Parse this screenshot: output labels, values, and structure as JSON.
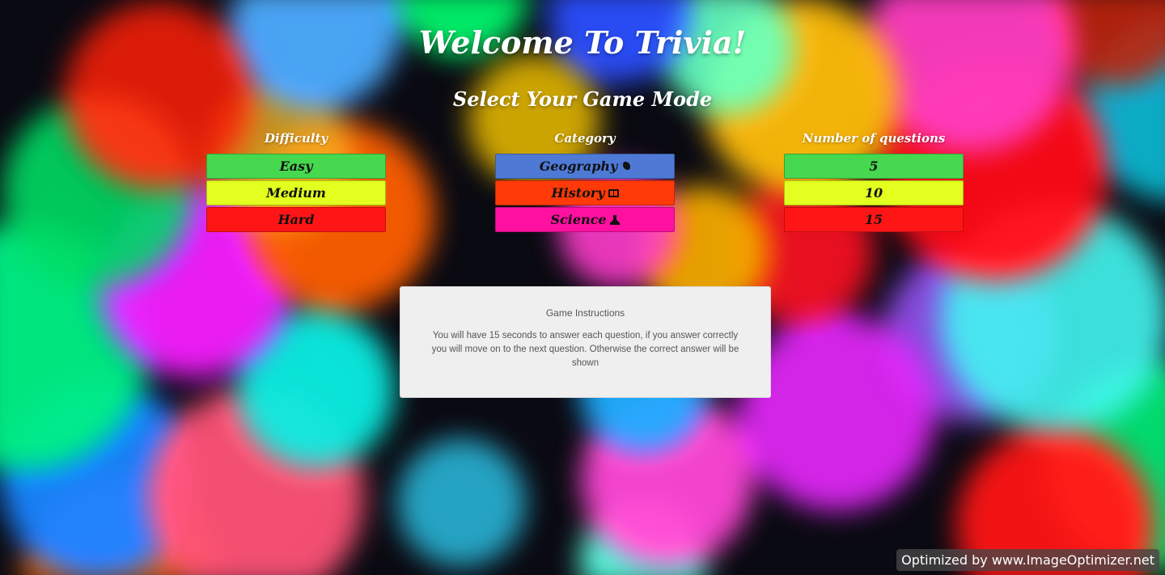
{
  "header": {
    "title": "Welcome To Trivia!",
    "subtitle": "Select Your Game Mode"
  },
  "difficulty": {
    "title": "Difficulty",
    "options": [
      {
        "label": "Easy",
        "color": "#46d84f"
      },
      {
        "label": "Medium",
        "color": "#e2ff1f"
      },
      {
        "label": "Hard",
        "color": "#ff1515"
      }
    ]
  },
  "category": {
    "title": "Category",
    "options": [
      {
        "label": "Geography",
        "icon": "globe-icon",
        "color": "#4e7ad6"
      },
      {
        "label": "History",
        "icon": "book-icon",
        "color": "#ff3a08"
      },
      {
        "label": "Science",
        "icon": "flask-icon",
        "color": "#ff10a0"
      }
    ]
  },
  "questions": {
    "title": "Number of questions",
    "options": [
      {
        "label": "5",
        "color": "#46d84f"
      },
      {
        "label": "10",
        "color": "#e2ff1f"
      },
      {
        "label": "15",
        "color": "#ff1515"
      }
    ]
  },
  "instructions": {
    "title": "Game Instructions",
    "text": "You will have 15 seconds to answer each question, if you answer correctly you will move on to the next question. Otherwise the correct answer will be shown"
  },
  "watermark": "Optimized by www.ImageOptimizer.net"
}
